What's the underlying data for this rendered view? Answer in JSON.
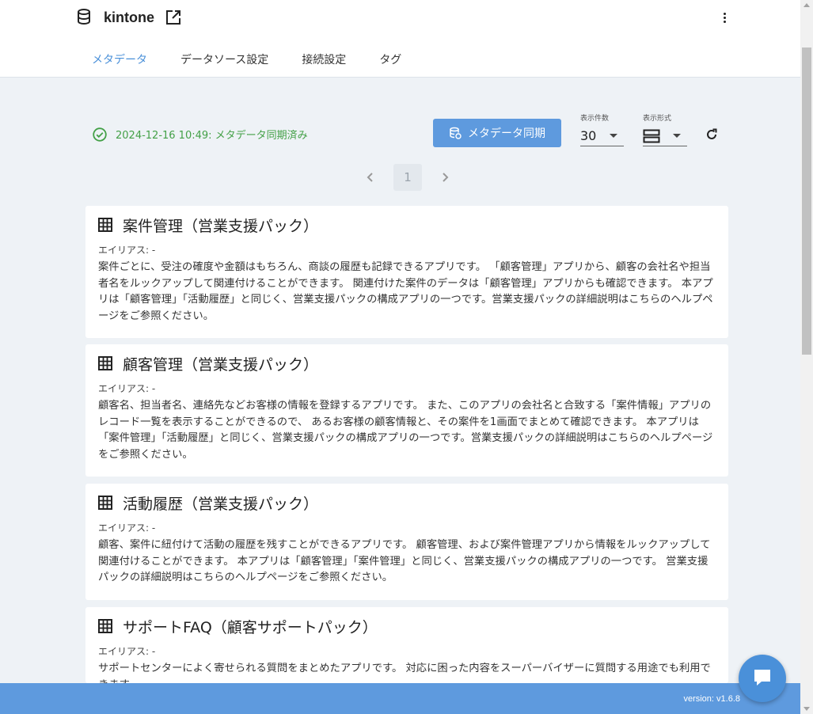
{
  "header": {
    "app_name": "kintone",
    "tabs": [
      {
        "label": "メタデータ",
        "active": true
      },
      {
        "label": "データソース設定",
        "active": false
      },
      {
        "label": "接続設定",
        "active": false
      },
      {
        "label": "タグ",
        "active": false
      }
    ]
  },
  "toolbar": {
    "status_text": "2024-12-16 10:49: メタデータ同期済み",
    "sync_button_label": "メタデータ同期",
    "count_label": "表示件数",
    "count_value": "30",
    "format_label": "表示形式"
  },
  "pagination": {
    "current_page": "1"
  },
  "apps": [
    {
      "name": "案件管理（営業支援パック）",
      "alias": "エイリアス: -",
      "description": "案件ごとに、受注の確度や金額はもちろん、商談の履歴も記録できるアプリです。 「顧客管理」アプリから、顧客の会社名や担当者名をルックアップして関連付けることができます。 関連付けた案件のデータは「顧客管理」アプリからも確認できます。 本アプリは「顧客管理」「活動履歴」と同じく、営業支援パックの構成アプリの一つです。営業支援パックの詳細説明はこちらのヘルプページをご参照ください。"
    },
    {
      "name": "顧客管理（営業支援パック）",
      "alias": "エイリアス: -",
      "description": "顧客名、担当者名、連絡先などお客様の情報を登録するアプリです。 また、このアプリの会社名と合致する「案件情報」アプリのレコード一覧を表示することができるので、 あるお客様の顧客情報と、その案件を1画面でまとめて確認できます。 本アプリは「案件管理」「活動履歴」と同じく、営業支援パックの構成アプリの一つです。営業支援パックの詳細説明はこちらのヘルプページをご参照ください。"
    },
    {
      "name": "活動履歴（営業支援パック）",
      "alias": "エイリアス: -",
      "description": "顧客、案件に紐付けて活動の履歴を残すことができるアプリです。 顧客管理、および案件管理アプリから情報をルックアップして関連付けることができます。 本アプリは「顧客管理」「案件管理」と同じく、営業支援パックの構成アプリの一つです。 営業支援パックの詳細説明はこちらのヘルプページをご参照ください。"
    },
    {
      "name": "サポートFAQ（顧客サポートパック）",
      "alias": "エイリアス: -",
      "description": "サポートセンターによく寄せられる質問をまとめたアプリです。 対応に困った内容をスーパーバイザーに質問する用途でも利用できます。"
    }
  ],
  "footer": {
    "version": "version: v1.6.8"
  },
  "colors": {
    "accent": "#5e9ade",
    "active_tab": "#4a90d9",
    "status_ok": "#43a047",
    "background": "#eef2f6"
  }
}
